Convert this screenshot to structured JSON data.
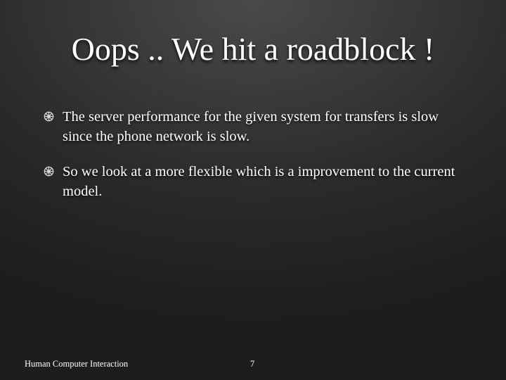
{
  "slide": {
    "title": "Oops .. We hit a roadblock !",
    "bullets": [
      {
        "icon": "ship-wheel-icon",
        "text": "The server performance for the given system for transfers is slow since the phone network is slow."
      },
      {
        "icon": "ship-wheel-icon",
        "text": "So we look at a more flexible which is a improvement to the current model."
      }
    ],
    "footer": {
      "left_text": "Human Computer Interaction",
      "page_number": "7"
    }
  },
  "colors": {
    "text": "#ffffff",
    "background_light": "#4a4a4a",
    "background_dark": "#1d1d1d"
  }
}
